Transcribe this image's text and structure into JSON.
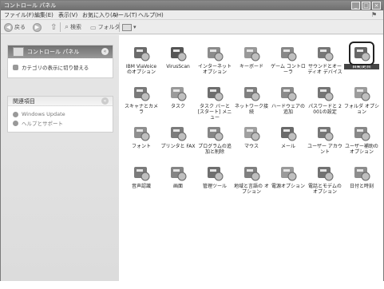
{
  "window": {
    "title": "コントロール パネル",
    "buttons": [
      "_",
      "□",
      "×"
    ]
  },
  "menu": [
    "ファイル(F)",
    "編集(E)",
    "表示(V)",
    "お気に入り(A)",
    "ツール(T)",
    "ヘルプ(H)"
  ],
  "toolbar": {
    "back": "戻る",
    "search": "検索",
    "folders": "フォルダ"
  },
  "sidebar": {
    "panel1": {
      "title": "コントロール パネル",
      "link": "カテゴリの表示に切り替える"
    },
    "panel2": {
      "title": "関連項目",
      "links": [
        "Windows Update",
        "ヘルプとサポート"
      ]
    }
  },
  "items": [
    {
      "label": "IBM ViaVoice のオプション",
      "icon": "viavoice-icon",
      "color": "#6b6b6b"
    },
    {
      "label": "VirusScan",
      "icon": "virusscan-icon",
      "color": "#555"
    },
    {
      "label": "インターネット オプション",
      "icon": "internet-options-icon",
      "color": "#8c8c8c"
    },
    {
      "label": "キーボード",
      "icon": "keyboard-icon",
      "color": "#999"
    },
    {
      "label": "ゲーム コントローラ",
      "icon": "game-controller-icon",
      "color": "#888"
    },
    {
      "label": "サウンドとオーディオ デバイス",
      "icon": "sound-icon",
      "color": "#777"
    },
    {
      "label": "自動更新",
      "icon": "automatic-updates-icon",
      "color": "#666"
    },
    {
      "label": "スキャナとカメラ",
      "icon": "scanner-camera-icon",
      "color": "#7a7a7a"
    },
    {
      "label": "タスク",
      "icon": "scheduled-tasks-icon",
      "color": "#9a9a9a"
    },
    {
      "label": "タスク バーと [スタート] メニュー",
      "icon": "taskbar-icon",
      "color": "#6e6e6e"
    },
    {
      "label": "ネットワーク接続",
      "icon": "network-icon",
      "color": "#808080"
    },
    {
      "label": "ハードウェアの追加",
      "icon": "add-hardware-icon",
      "color": "#8a8a8a"
    },
    {
      "label": "パスワードと 2001の設定",
      "icon": "password-icon",
      "color": "#757575"
    },
    {
      "label": "フォルダ オプション",
      "icon": "folder-options-icon",
      "color": "#9c9c9c"
    },
    {
      "label": "フォント",
      "icon": "fonts-icon",
      "color": "#8f8f8f"
    },
    {
      "label": "プリンタと FAX",
      "icon": "printers-icon",
      "color": "#7c7c7c"
    },
    {
      "label": "プログラムの追加と削除",
      "icon": "add-remove-programs-icon",
      "color": "#868686"
    },
    {
      "label": "マウス",
      "icon": "mouse-icon",
      "color": "#a0a0a0"
    },
    {
      "label": "メール",
      "icon": "mail-icon",
      "color": "#6a6a6a"
    },
    {
      "label": "ユーザー アカウント",
      "icon": "user-accounts-icon",
      "color": "#777"
    },
    {
      "label": "ユーザー補助の オプション",
      "icon": "accessibility-icon",
      "color": "#888"
    },
    {
      "label": "音声認識",
      "icon": "speech-icon",
      "color": "#7b7b7b"
    },
    {
      "label": "画面",
      "icon": "display-icon",
      "color": "#858585"
    },
    {
      "label": "管理ツール",
      "icon": "admin-tools-icon",
      "color": "#6f6f6f"
    },
    {
      "label": "地域と言語の オプション",
      "icon": "regional-icon",
      "color": "#808080"
    },
    {
      "label": "電源オプション",
      "icon": "power-icon",
      "color": "#9a9a9a"
    },
    {
      "label": "電話とモデムの オプション",
      "icon": "phone-modem-icon",
      "color": "#727272"
    },
    {
      "label": "日付と時刻",
      "icon": "date-time-icon",
      "color": "#8d8d8d"
    }
  ],
  "selected_index": 6
}
